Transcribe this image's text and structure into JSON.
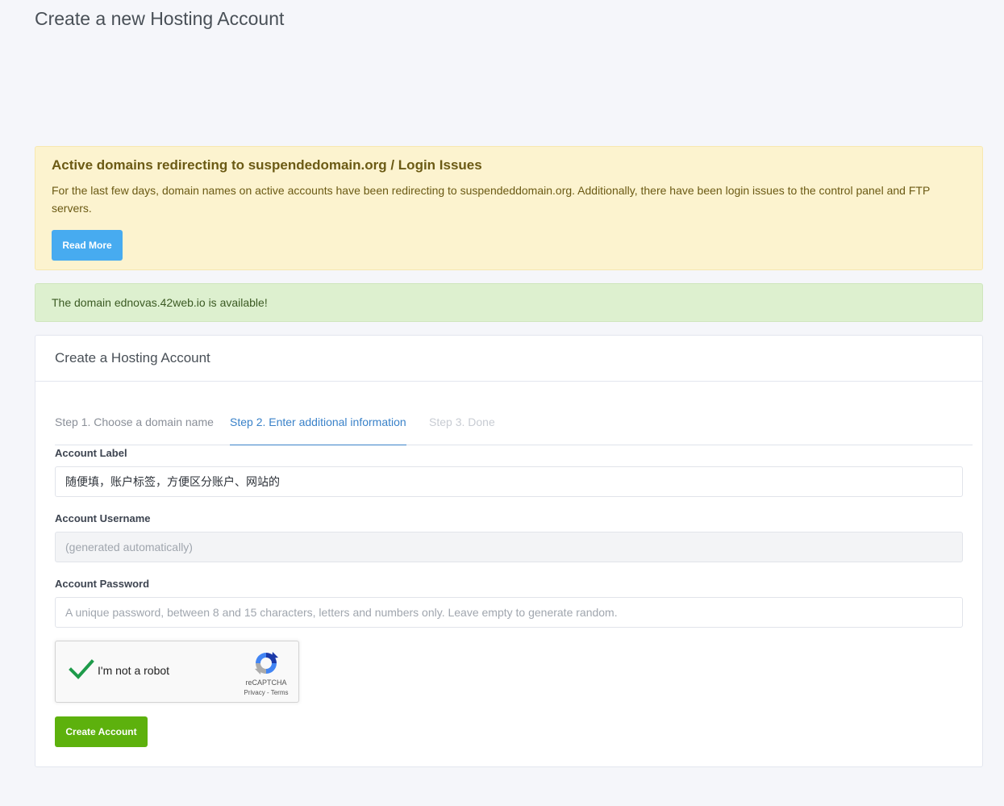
{
  "page": {
    "title": "Create a new Hosting Account"
  },
  "notice": {
    "title": "Active domains redirecting to suspendedomain.org / Login Issues",
    "body": "For the last few days, domain names on active accounts have been redirecting to suspendeddomain.org. Additionally, there have been login issues to the control panel and FTP servers.",
    "button_label": "Read More",
    "color": "#fcf3cf"
  },
  "availability": {
    "message": "The domain ednovas.42web.io is available!",
    "color": "#ddf0cf"
  },
  "card": {
    "title": "Create a Hosting Account",
    "steps": [
      {
        "label": "Step 1. Choose a domain name",
        "state": "completed"
      },
      {
        "label": "Step 2. Enter additional information",
        "state": "active"
      },
      {
        "label": "Step 3. Done",
        "state": "disabled"
      }
    ],
    "fields": {
      "label": {
        "label": "Account Label",
        "value": "随便填，账户标签，方便区分账户、网站的",
        "placeholder": ""
      },
      "username": {
        "label": "Account Username",
        "value": "",
        "placeholder": "(generated automatically)"
      },
      "password": {
        "label": "Account Password",
        "value": "",
        "placeholder": "A unique password, between 8 and 15 characters, letters and numbers only. Leave empty to generate random."
      }
    },
    "recaptcha": {
      "label": "I'm not a robot",
      "brand": "reCAPTCHA",
      "links": "Privacy - Terms",
      "checked": true,
      "icon": "recaptcha-logo-icon"
    },
    "submit_label": "Create Account"
  },
  "colors": {
    "accent_blue": "#47abf0",
    "active_tab": "#3a82c9",
    "submit_green": "#5db10d",
    "check_green": "#1e9b4a"
  }
}
